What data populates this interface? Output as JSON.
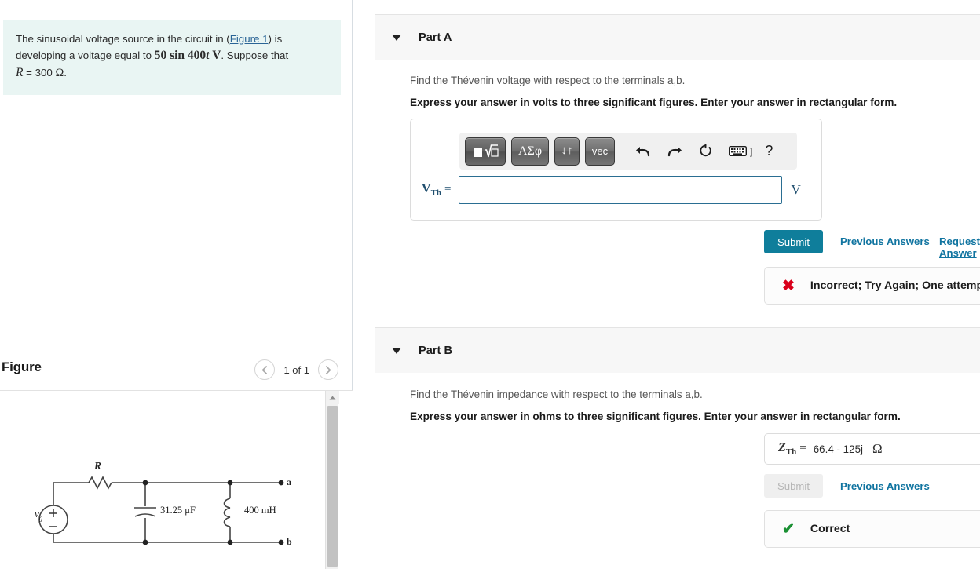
{
  "question": {
    "line1_a": "The sinusoidal voltage source in the circuit in ",
    "figure_link": "Figure 1",
    "line1_b": ") is",
    "line1_open": "(",
    "line2_a": "developing a voltage equal to ",
    "line2_math": "50 sin 400",
    "line2_math_var": "t",
    "line2_math_unit": "V",
    "line2_b": ". Suppose that",
    "line3_var": "R",
    "line3_eq": " = 300 ",
    "line3_unit": "Ω",
    "line3_period": "."
  },
  "figure": {
    "title": "Figure",
    "prev_icon": "chevron-left",
    "next_icon": "chevron-right",
    "counter": "1 of 1",
    "circuit": {
      "source_label": "v",
      "source_sub": "g",
      "source_plus": "+",
      "source_minus": "−",
      "resistor_label": "R",
      "capacitor_label": "31.25 μF",
      "inductor_label": "400 mH",
      "terminal_a": "a",
      "terminal_b": "b"
    },
    "scroll_up_icon": "triangle-up"
  },
  "toolbar": {
    "buttons": [
      {
        "name": "template-root-button",
        "glyph": "√"
      },
      {
        "name": "greek-letters-button",
        "glyph": "ΑΣφ"
      },
      {
        "name": "arrows-button",
        "glyph": "↓↑"
      },
      {
        "name": "vector-button",
        "glyph": "vec"
      }
    ],
    "undo_icon": "undo-arrow",
    "redo_icon": "redo-arrow",
    "reset_icon": "reset-circle",
    "keyboard_icon": "keyboard",
    "keyboard_suffix": "]",
    "help_icon": "?"
  },
  "parts": [
    {
      "id": "part-a",
      "label": "Part A",
      "prompt": "Find the Thévenin voltage with respect to the terminals a,b.",
      "instruction": "Express your answer in volts to three significant figures. Enter your answer in rectangular form.",
      "answer": {
        "var_main": "V",
        "var_sub": "Th",
        "equals": "=",
        "value": "",
        "placeholder": "",
        "unit": "V"
      },
      "submit_label": "Submit",
      "submit_disabled": false,
      "links": [
        "Previous Answers",
        "Request Answer"
      ],
      "feedback": {
        "icon": "x-mark",
        "color": "#d9001b",
        "text": "Incorrect; Try Again; One attempt remaining"
      }
    },
    {
      "id": "part-b",
      "label": "Part B",
      "prompt": "Find the Thévenin impedance with respect to the terminals a,b.",
      "instruction": "Express your answer in ohms to three significant figures. Enter your answer in rectangular form.",
      "answer": {
        "var_main": "Z",
        "var_sub": "Th",
        "equals": "=",
        "value": "66.4 - 125j",
        "unit": "Ω"
      },
      "submit_label": "Submit",
      "submit_disabled": true,
      "links": [
        "Previous Answers"
      ],
      "feedback": {
        "icon": "check-mark",
        "color": "#1a9033",
        "text": "Correct"
      }
    }
  ],
  "colors": {
    "accent": "#0f7e9b",
    "link": "#1074a0",
    "question_bg": "#e9f5f3",
    "header_bg": "#f7f7f7",
    "incorrect": "#d9001b",
    "correct": "#1a9033"
  }
}
